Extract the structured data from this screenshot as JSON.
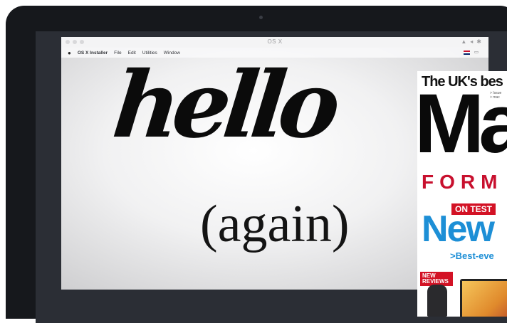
{
  "window": {
    "title": "OS X"
  },
  "menubar": {
    "apple": "",
    "items": [
      "OS X Installer",
      "File",
      "Edit",
      "Utilities",
      "Window"
    ],
    "right_icon": "™"
  },
  "screen": {
    "headline": "hello",
    "subline": "(again)"
  },
  "magazine": {
    "strap": "The UK's bes",
    "bullets": [
      "> Issue",
      "> mac"
    ],
    "logo": "Ma",
    "format_word": "FORM",
    "ontest": "ON TEST",
    "new": "New",
    "best": ">Best-eve",
    "reviews": "NEW REVIEWS"
  },
  "colors": {
    "magazine_red": "#d31225",
    "magazine_blue": "#1d8fd6"
  }
}
